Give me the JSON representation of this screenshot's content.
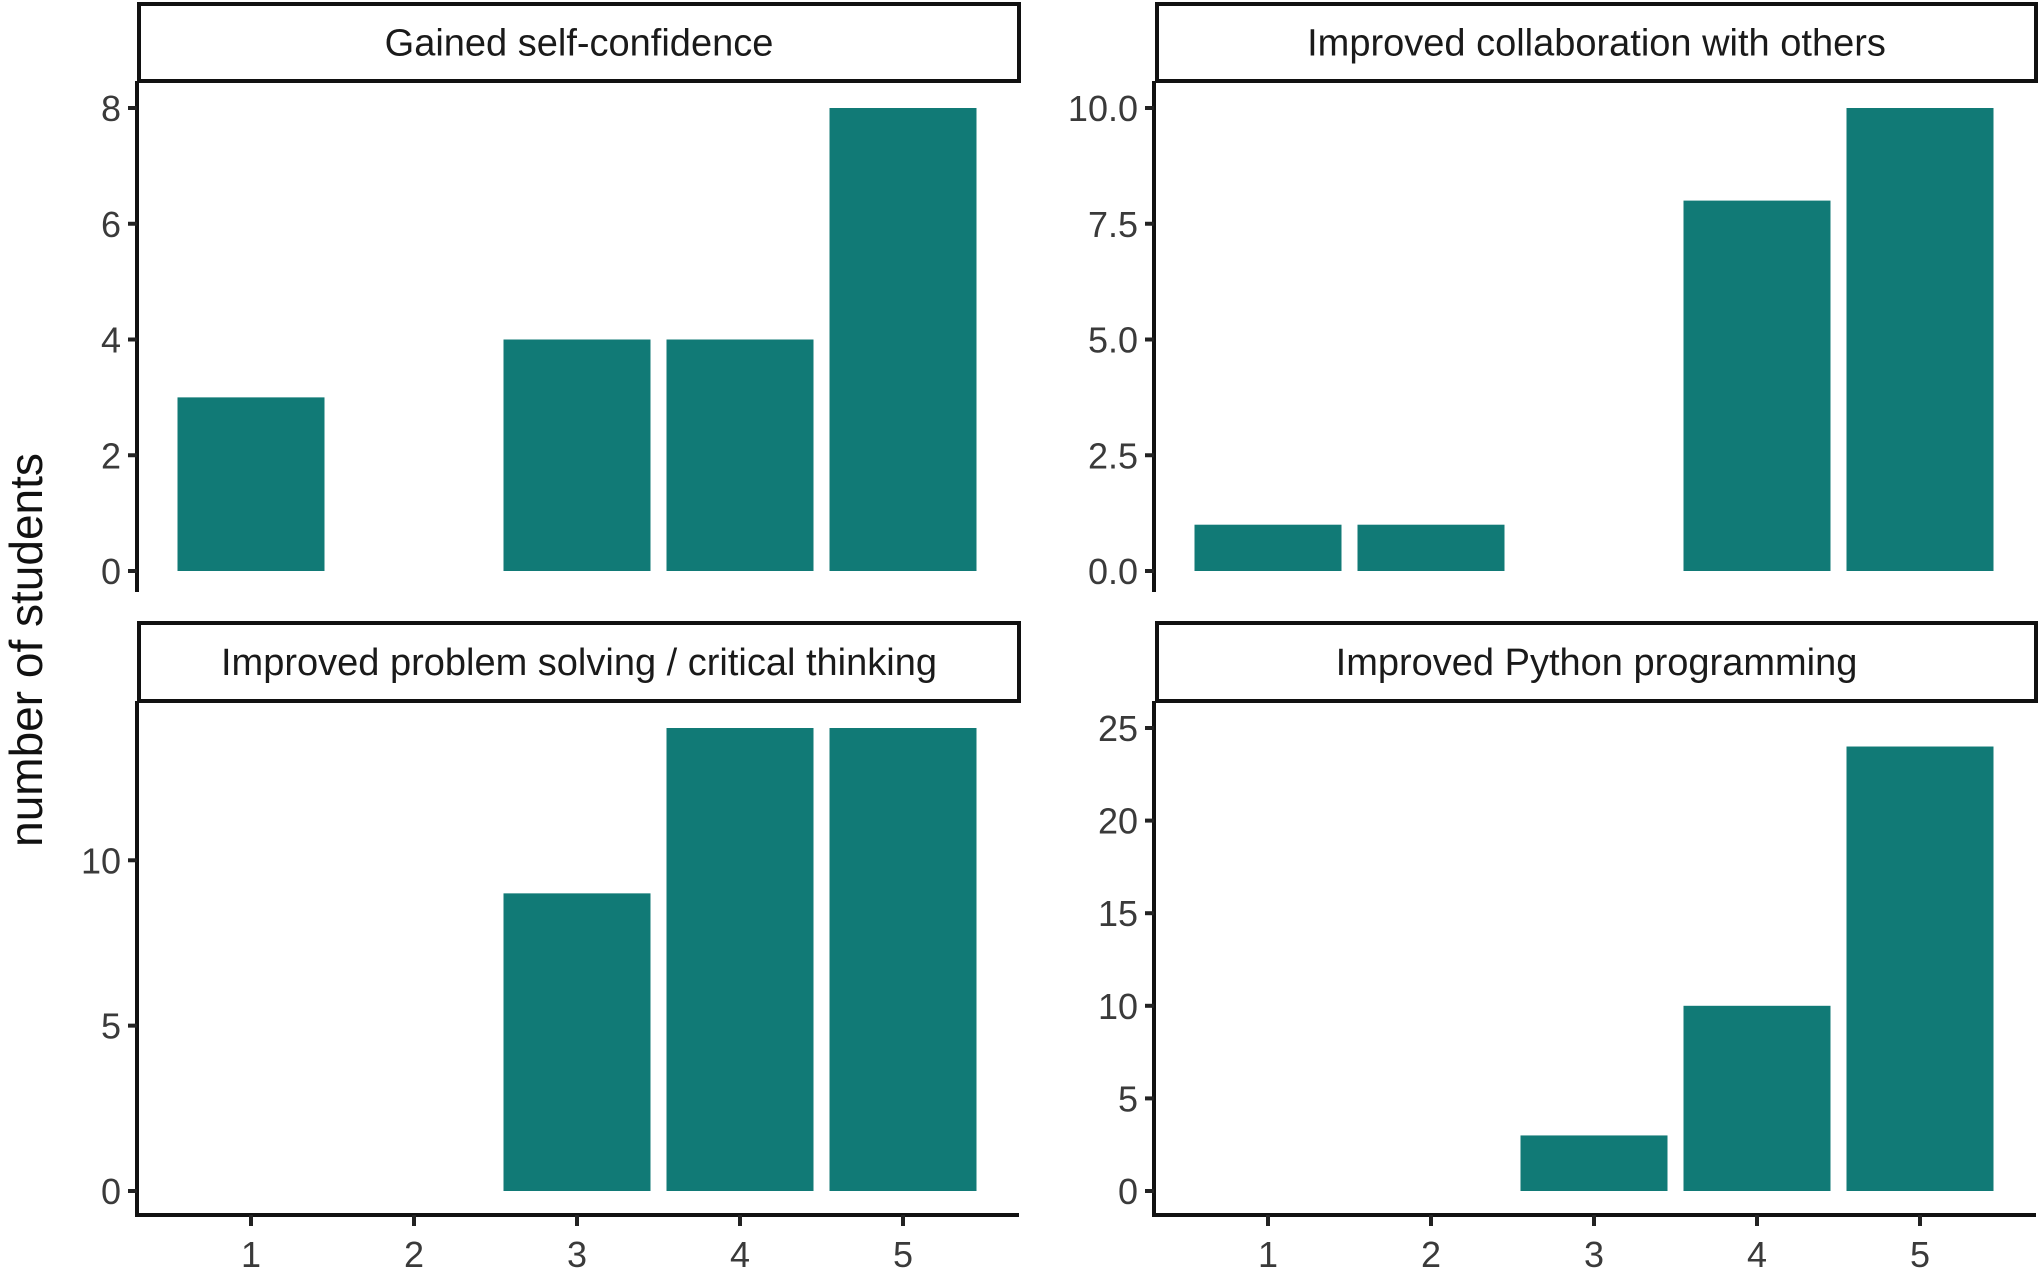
{
  "chart_data": {
    "type": "bar",
    "layout": "facet-grid-2x2",
    "ylabel": "number of students",
    "xlabel": "",
    "bar_color": "#117a76",
    "categories": [
      "1",
      "2",
      "3",
      "4",
      "5"
    ],
    "panels": [
      {
        "title": "Gained self-confidence",
        "values": [
          3,
          0,
          4,
          4,
          8
        ],
        "ylim": [
          0,
          8
        ],
        "yticks": [
          0,
          2,
          4,
          6,
          8
        ],
        "ytick_labels": [
          "0",
          "2",
          "4",
          "6",
          "8"
        ]
      },
      {
        "title": "Improved collaboration with others",
        "values": [
          1,
          1,
          0,
          8,
          10
        ],
        "ylim": [
          0,
          10
        ],
        "yticks": [
          0,
          2.5,
          5,
          7.5,
          10
        ],
        "ytick_labels": [
          "0.0",
          "2.5",
          "5.0",
          "7.5",
          "10.0"
        ]
      },
      {
        "title": "Improved problem solving / critical thinking",
        "values": [
          0,
          0,
          9,
          14,
          14
        ],
        "ylim": [
          0,
          14
        ],
        "yticks": [
          0,
          5,
          10
        ],
        "ytick_labels": [
          "0",
          "5",
          "10"
        ]
      },
      {
        "title": "Improved Python programming",
        "values": [
          0,
          0,
          3,
          10,
          24
        ],
        "ylim": [
          0,
          25
        ],
        "yticks": [
          0,
          5,
          10,
          15,
          20,
          25
        ],
        "ytick_labels": [
          "0",
          "5",
          "10",
          "15",
          "20",
          "25"
        ]
      }
    ],
    "x_axis_shown_on": "bottom-row",
    "grid": false,
    "legend": "none"
  }
}
